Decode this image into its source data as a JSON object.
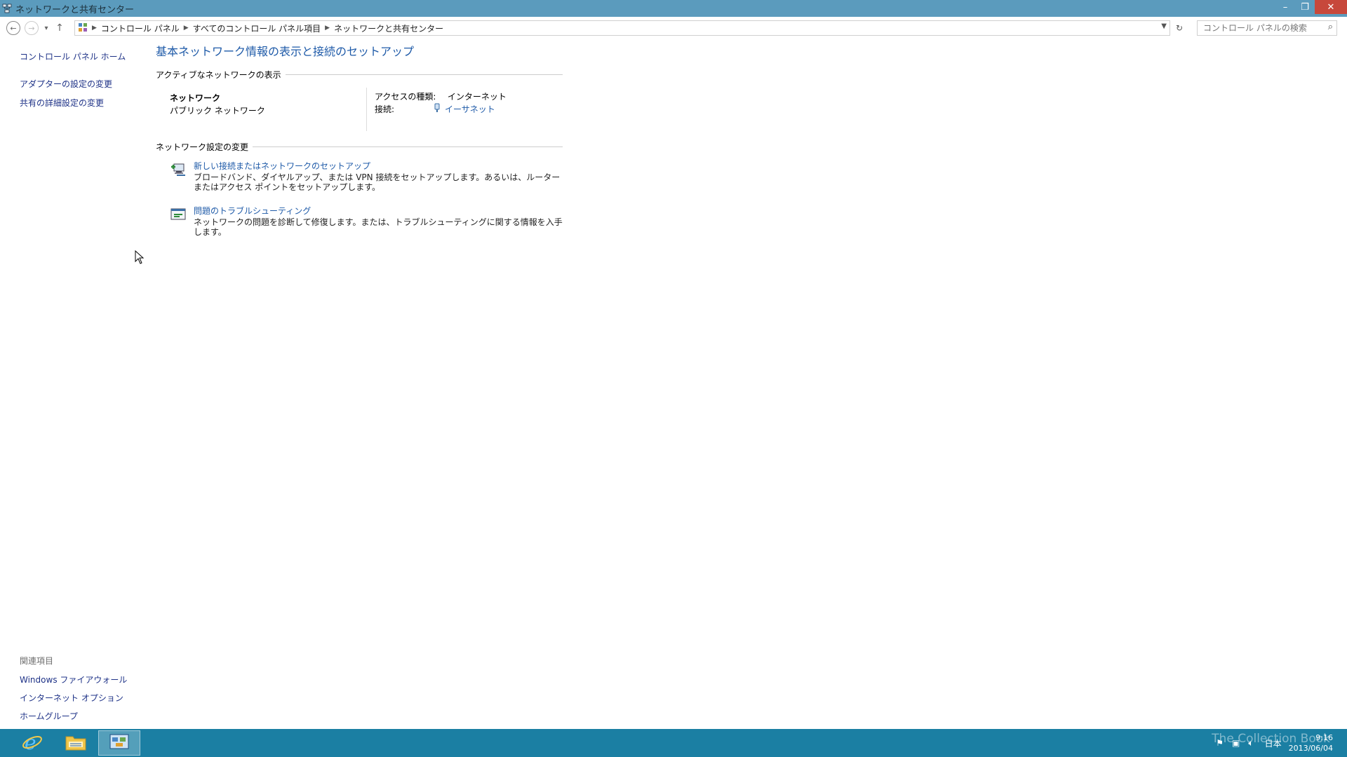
{
  "window": {
    "title": "ネットワークと共有センター",
    "minimize": "–",
    "restore": "❐",
    "close": "✕"
  },
  "nav": {
    "back": "←",
    "forward": "→",
    "recent": "▾",
    "up": "↑",
    "breadcrumbs": [
      "コントロール パネル",
      "すべてのコントロール パネル項目",
      "ネットワークと共有センター"
    ],
    "refresh": "↻",
    "search_placeholder": "コントロール パネルの検索"
  },
  "sidebar": {
    "home": "コントロール パネル ホーム",
    "items": [
      "アダプターの設定の変更",
      "共有の詳細設定の変更"
    ]
  },
  "related": {
    "header": "関連項目",
    "items": [
      "Windows ファイアウォール",
      "インターネット オプション",
      "ホームグループ"
    ]
  },
  "main": {
    "heading": "基本ネットワーク情報の表示と接続のセットアップ",
    "active_section": "アクティブなネットワークの表示",
    "network_name": "ネットワーク",
    "network_type": "パブリック ネットワーク",
    "access_label": "アクセスの種類:",
    "access_value": "インターネット",
    "connection_label": "接続:",
    "connection_value": "イーサネット",
    "change_section": "ネットワーク設定の変更",
    "tasks": [
      {
        "title": "新しい接続またはネットワークのセットアップ",
        "desc": "ブロードバンド、ダイヤルアップ、または VPN 接続をセットアップします。あるいは、ルーターまたはアクセス ポイントをセットアップします。"
      },
      {
        "title": "問題のトラブルシューティング",
        "desc": "ネットワークの問題を診断して修復します。または、トラブルシューティングに関する情報を入手します。"
      }
    ]
  },
  "taskbar": {
    "lang": "日本",
    "time": "9:16",
    "date": "2013/06/04",
    "watermark": "The Collection Book"
  },
  "colors": {
    "titlebar": "#5b9bbd",
    "taskbar": "#1b7fa3",
    "link": "#1e5aa8"
  }
}
